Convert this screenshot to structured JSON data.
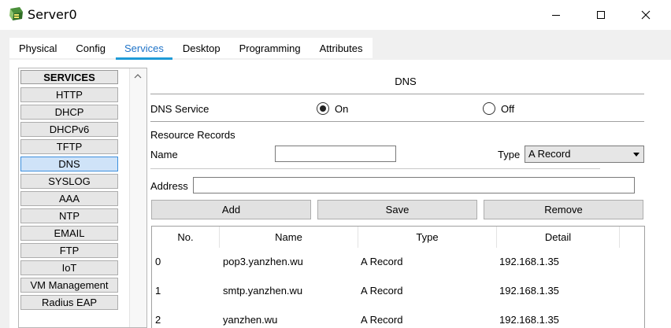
{
  "window": {
    "title": "Server0",
    "minimize_icon": "minimize-icon",
    "maximize_icon": "maximize-icon",
    "close_icon": "close-icon"
  },
  "tabs": [
    {
      "label": "Physical"
    },
    {
      "label": "Config"
    },
    {
      "label": "Services",
      "active": true
    },
    {
      "label": "Desktop"
    },
    {
      "label": "Programming"
    },
    {
      "label": "Attributes"
    }
  ],
  "services": {
    "header": "SERVICES",
    "items": [
      {
        "label": "HTTP"
      },
      {
        "label": "DHCP"
      },
      {
        "label": "DHCPv6"
      },
      {
        "label": "TFTP"
      },
      {
        "label": "DNS",
        "selected": true
      },
      {
        "label": "SYSLOG"
      },
      {
        "label": "AAA"
      },
      {
        "label": "NTP"
      },
      {
        "label": "EMAIL"
      },
      {
        "label": "FTP"
      },
      {
        "label": "IoT"
      },
      {
        "label": "VM Management"
      },
      {
        "label": "Radius EAP"
      }
    ]
  },
  "dns": {
    "title": "DNS",
    "service_label": "DNS Service",
    "on_label": "On",
    "off_label": "Off",
    "service_state": "On",
    "resource_records_label": "Resource Records",
    "name_label": "Name",
    "name_value": "",
    "type_label": "Type",
    "type_value": "A Record",
    "address_label": "Address",
    "address_value": "",
    "add_label": "Add",
    "save_label": "Save",
    "remove_label": "Remove",
    "columns": [
      "No.",
      "Name",
      "Type",
      "Detail"
    ],
    "records": [
      {
        "no": "0",
        "name": "pop3.yanzhen.wu",
        "type": "A Record",
        "detail": "192.168.1.35"
      },
      {
        "no": "1",
        "name": "smtp.yanzhen.wu",
        "type": "A Record",
        "detail": "192.168.1.35"
      },
      {
        "no": "2",
        "name": "yanzhen.wu",
        "type": "A Record",
        "detail": "192.168.1.35"
      }
    ]
  },
  "colors": {
    "accent": "#1e9bd7",
    "active_tab_text": "#1e73c8",
    "selected_service_bg": "#cfe3f8"
  }
}
